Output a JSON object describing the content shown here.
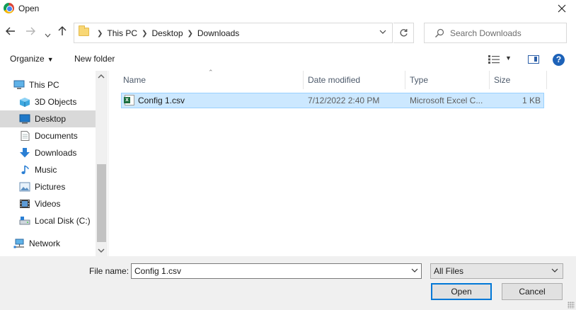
{
  "window": {
    "title": "Open"
  },
  "navigation": {
    "breadcrumb": [
      "This PC",
      "Desktop",
      "Downloads"
    ]
  },
  "search": {
    "placeholder": "Search Downloads"
  },
  "toolbar": {
    "organize_label": "Organize",
    "new_folder_label": "New folder",
    "help_label": "?"
  },
  "sidebar": {
    "items": [
      {
        "label": "This PC",
        "icon": "computer-icon",
        "indent": 0,
        "selected": false
      },
      {
        "label": "3D Objects",
        "icon": "cube-icon",
        "indent": 1,
        "selected": false
      },
      {
        "label": "Desktop",
        "icon": "desktop-icon",
        "indent": 1,
        "selected": true
      },
      {
        "label": "Documents",
        "icon": "document-icon",
        "indent": 1,
        "selected": false
      },
      {
        "label": "Downloads",
        "icon": "download-arrow-icon",
        "indent": 1,
        "selected": false
      },
      {
        "label": "Music",
        "icon": "music-note-icon",
        "indent": 1,
        "selected": false
      },
      {
        "label": "Pictures",
        "icon": "picture-icon",
        "indent": 1,
        "selected": false
      },
      {
        "label": "Videos",
        "icon": "film-icon",
        "indent": 1,
        "selected": false
      },
      {
        "label": "Local Disk (C:)",
        "icon": "drive-icon",
        "indent": 1,
        "selected": false
      },
      {
        "label": "Network",
        "icon": "network-icon",
        "indent": 0,
        "selected": false
      }
    ]
  },
  "file_list": {
    "columns": [
      "Name",
      "Date modified",
      "Type",
      "Size"
    ],
    "rows": [
      {
        "name": "Config 1.csv",
        "date": "7/12/2022 2:40 PM",
        "type": "Microsoft Excel C...",
        "size": "1 KB",
        "icon": "excel-csv-icon",
        "selected": true
      }
    ]
  },
  "bottom": {
    "file_name_label": "File name:",
    "file_name_value": "Config 1.csv",
    "file_type_value": "All Files",
    "open_label": "Open",
    "cancel_label": "Cancel"
  },
  "colors": {
    "selection_fill": "#cce8ff",
    "selection_border": "#99d1ff",
    "accent": "#0078d7"
  }
}
